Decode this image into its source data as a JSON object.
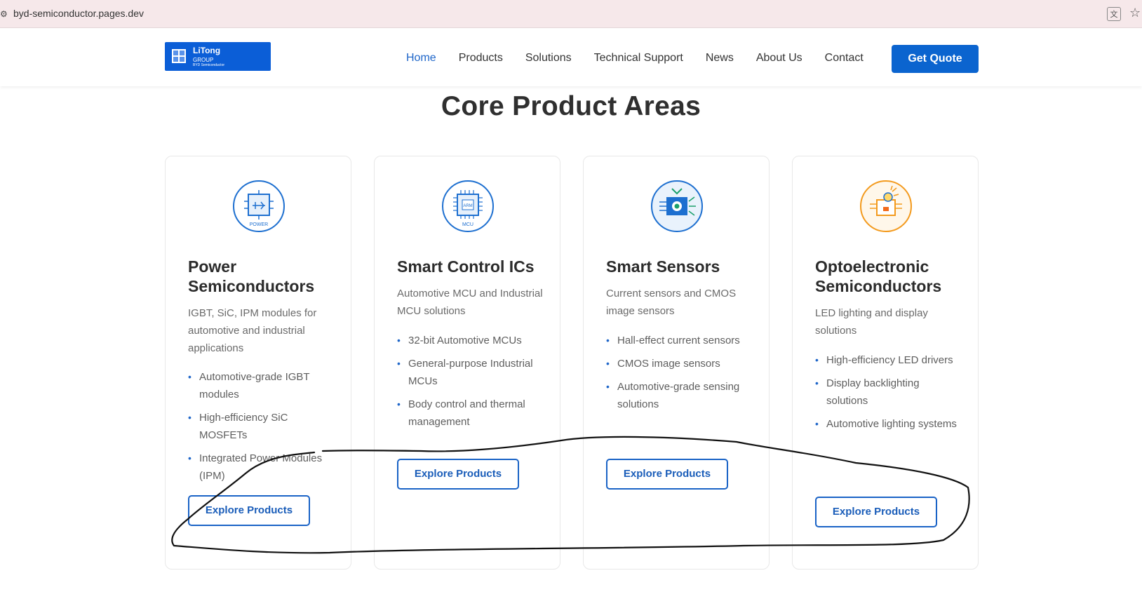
{
  "browser": {
    "url": "byd-semiconductor.pages.dev",
    "site_icon": "page-info-icon",
    "translate_icon": "translate-icon",
    "star_icon": "star-icon"
  },
  "header": {
    "logo": {
      "line1": "LiTong",
      "line2": "GROUP",
      "line3": "BYD Semiconductor"
    },
    "nav": [
      {
        "label": "Home",
        "active": true
      },
      {
        "label": "Products"
      },
      {
        "label": "Solutions"
      },
      {
        "label": "Technical Support"
      },
      {
        "label": "News"
      },
      {
        "label": "About Us"
      },
      {
        "label": "Contact"
      }
    ],
    "cta": "Get Quote",
    "accent_color": "#0b64cf"
  },
  "section_title": "Core Product Areas",
  "cards": [
    {
      "icon": "power-chip-icon",
      "icon_label": "POWER",
      "title": "Power Semiconductors",
      "description": "IGBT, SiC, IPM modules for automotive and industrial applications",
      "features": [
        "Automotive-grade IGBT modules",
        "High-efficiency SiC MOSFETs",
        "Integrated Power Modules (IPM)"
      ],
      "button": "Explore Products"
    },
    {
      "icon": "mcu-chip-icon",
      "icon_label": "MCU",
      "icon_chip_text": "ARM",
      "title": "Smart Control ICs",
      "description": "Automotive MCU and Industrial MCU solutions",
      "features": [
        "32-bit Automotive MCUs",
        "General-purpose Industrial MCUs",
        "Body control and thermal management"
      ],
      "button": "Explore Products"
    },
    {
      "icon": "sensor-icon",
      "title": "Smart Sensors",
      "description": "Current sensors and CMOS image sensors",
      "features": [
        "Hall-effect current sensors",
        "CMOS image sensors",
        "Automotive-grade sensing solutions"
      ],
      "button": "Explore Products"
    },
    {
      "icon": "optoelectronic-icon",
      "title": "Optoelectronic Semiconductors",
      "description": "LED lighting and display solutions",
      "features": [
        "High-efficiency LED drivers",
        "Display backlighting solutions",
        "Automotive lighting systems"
      ],
      "button": "Explore Products",
      "accent_color": "#f39a1d"
    }
  ]
}
